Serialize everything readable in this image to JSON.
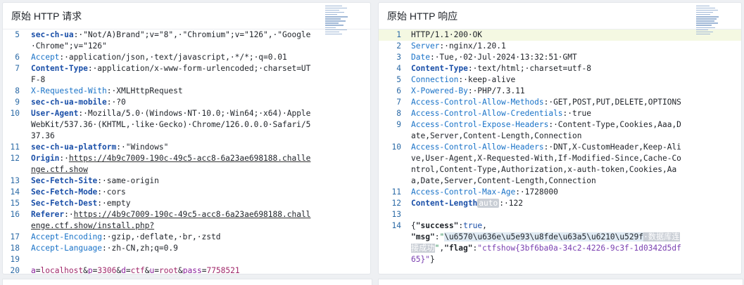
{
  "request": {
    "title": "原始 HTTP 请求",
    "lines": [
      {
        "n": "5",
        "parts": [
          [
            "kb",
            "sec-ch-ua"
          ],
          [
            "v",
            ":·\"Not/A)Brand\";v=\"8\",·\"Chromium\";v=\"126\",·\"Google·Chrome\";v=\"126\""
          ]
        ]
      },
      {
        "n": "6",
        "parts": [
          [
            "k",
            "Accept"
          ],
          [
            "v",
            ":·application/json,·text/javascript,·*/*;·q=0.01"
          ]
        ]
      },
      {
        "n": "7",
        "parts": [
          [
            "kb",
            "Content-Type"
          ],
          [
            "v",
            ":·application/x-www-form-urlencoded;·charset=UTF-8"
          ]
        ]
      },
      {
        "n": "8",
        "parts": [
          [
            "k",
            "X-Requested-With"
          ],
          [
            "v",
            ":·XMLHttpRequest"
          ]
        ]
      },
      {
        "n": "9",
        "parts": [
          [
            "kb",
            "sec-ch-ua-mobile"
          ],
          [
            "v",
            ":·?0"
          ]
        ]
      },
      {
        "n": "10",
        "parts": [
          [
            "kb",
            "User-Agent"
          ],
          [
            "v",
            ":·Mozilla/5.0·(Windows·NT·10.0;·Win64;·x64)·AppleWebKit/537.36·(KHTML,·like·Gecko)·Chrome/126.0.0.0·Safari/537.36"
          ]
        ]
      },
      {
        "n": "11",
        "parts": [
          [
            "kb",
            "sec-ch-ua-platform"
          ],
          [
            "v",
            ":·\"Windows\""
          ]
        ]
      },
      {
        "n": "12",
        "parts": [
          [
            "kb",
            "Origin"
          ],
          [
            "v",
            ":·"
          ],
          [
            "u",
            "https://4b9c7009-190c-49c5-acc8-6a23ae698188.challenge.ctf.show"
          ]
        ]
      },
      {
        "n": "13",
        "parts": [
          [
            "kb",
            "Sec-Fetch-Site"
          ],
          [
            "v",
            ":·same-origin"
          ]
        ]
      },
      {
        "n": "14",
        "parts": [
          [
            "kb",
            "Sec-Fetch-Mode"
          ],
          [
            "v",
            ":·cors"
          ]
        ]
      },
      {
        "n": "15",
        "parts": [
          [
            "kb",
            "Sec-Fetch-Dest"
          ],
          [
            "v",
            ":·empty"
          ]
        ]
      },
      {
        "n": "16",
        "parts": [
          [
            "kb",
            "Referer"
          ],
          [
            "v",
            ":·"
          ],
          [
            "u",
            "https://4b9c7009-190c-49c5-acc8-6a23ae698188.challenge.ctf.show/install.php?"
          ]
        ]
      },
      {
        "n": "17",
        "parts": [
          [
            "k",
            "Accept-Encoding"
          ],
          [
            "v",
            ":·gzip,·deflate,·br,·zstd"
          ]
        ]
      },
      {
        "n": "18",
        "parts": [
          [
            "k",
            "Accept-Language"
          ],
          [
            "v",
            ":·zh-CN,zh;q=0.9"
          ]
        ]
      },
      {
        "n": "19",
        "parts": []
      },
      {
        "n": "20",
        "form": true,
        "parts": [
          [
            "pk",
            "a"
          ],
          [
            "amp",
            "="
          ],
          [
            "pv",
            "localhost"
          ],
          [
            "amp",
            "&"
          ],
          [
            "pk",
            "p"
          ],
          [
            "amp",
            "="
          ],
          [
            "pv",
            "3306"
          ],
          [
            "amp",
            "&"
          ],
          [
            "pk",
            "d"
          ],
          [
            "amp",
            "="
          ],
          [
            "pv",
            "ctf"
          ],
          [
            "amp",
            "&"
          ],
          [
            "pk",
            "u"
          ],
          [
            "amp",
            "="
          ],
          [
            "pv",
            "root"
          ],
          [
            "amp",
            "&"
          ],
          [
            "pk",
            "pass"
          ],
          [
            "amp",
            "="
          ],
          [
            "pv",
            "7758521"
          ]
        ]
      }
    ]
  },
  "response": {
    "title": "原始 HTTP 响应",
    "lines": [
      {
        "n": "1",
        "hl": true,
        "parts": [
          [
            "v",
            "HTTP/1.1·200·OK"
          ]
        ]
      },
      {
        "n": "2",
        "parts": [
          [
            "k",
            "Server"
          ],
          [
            "v",
            ":·nginx/1.20.1"
          ]
        ]
      },
      {
        "n": "3",
        "parts": [
          [
            "k",
            "Date"
          ],
          [
            "v",
            ":·Tue,·02·Jul·2024·13:32:51·GMT"
          ]
        ]
      },
      {
        "n": "4",
        "parts": [
          [
            "kb",
            "Content-Type"
          ],
          [
            "v",
            ":·text/html;·charset=utf-8"
          ]
        ]
      },
      {
        "n": "5",
        "parts": [
          [
            "k",
            "Connection"
          ],
          [
            "v",
            ":·keep-alive"
          ]
        ]
      },
      {
        "n": "6",
        "parts": [
          [
            "k",
            "X-Powered-By"
          ],
          [
            "v",
            ":·PHP/7.3.11"
          ]
        ]
      },
      {
        "n": "7",
        "parts": [
          [
            "k",
            "Access-Control-Allow-Methods"
          ],
          [
            "v",
            ":·GET,POST,PUT,DELETE,OPTIONS"
          ]
        ]
      },
      {
        "n": "8",
        "parts": [
          [
            "k",
            "Access-Control-Allow-Credentials"
          ],
          [
            "v",
            ":·true"
          ]
        ]
      },
      {
        "n": "9",
        "parts": [
          [
            "k",
            "Access-Control-Expose-Headers"
          ],
          [
            "v",
            ":·Content-Type,Cookies,Aaa,Date,Server,Content-Length,Connection"
          ]
        ]
      },
      {
        "n": "10",
        "parts": [
          [
            "k",
            "Access-Control-Allow-Headers"
          ],
          [
            "v",
            ":·DNT,X-CustomHeader,Keep-Alive,User-Agent,X-Requested-With,If-Modified-Since,Cache-Control,Content-Type,Authorization,x-auth-token,Cookies,Aaa,Date,Server,Content-Length,Connection"
          ]
        ]
      },
      {
        "n": "11",
        "parts": [
          [
            "k",
            "Access-Control-Max-Age"
          ],
          [
            "v",
            ":·1728000"
          ]
        ]
      },
      {
        "n": "12",
        "parts": [
          [
            "kb",
            "Content-Length"
          ],
          [
            "pill",
            "auto"
          ],
          [
            "v",
            ":·122"
          ]
        ]
      },
      {
        "n": "13",
        "parts": []
      },
      {
        "n": "14",
        "parts": [
          [
            "v",
            "{"
          ],
          [
            "jk",
            "\"success\""
          ],
          [
            "v",
            ":"
          ],
          [
            "jv",
            "true"
          ],
          [
            "v",
            ",\n"
          ],
          [
            "jk",
            "\"msg\""
          ],
          [
            "v",
            ":"
          ],
          [
            "js",
            "\""
          ],
          [
            "esc",
            "\\u6570\\u636e\\u5e93\\u8fde\\u63a5\\u6210\\u529f"
          ],
          [
            "cjk",
            "·数据库连接成功"
          ],
          [
            "js",
            "\""
          ],
          [
            "v",
            ","
          ],
          [
            "jk",
            "\"flag\""
          ],
          [
            "v",
            ":"
          ],
          [
            "jg",
            "\"ctfshow{3bf6ba0a-34c2-4226-9c3f-1d0342d5df65}\""
          ],
          [
            "v",
            "}"
          ]
        ]
      }
    ]
  }
}
